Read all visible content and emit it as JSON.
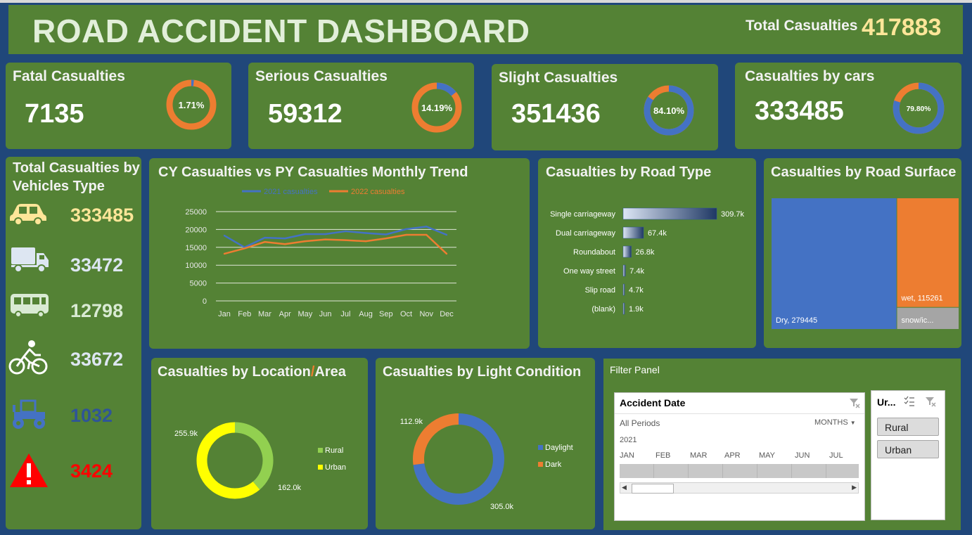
{
  "header": {
    "title": "ROAD ACCIDENT DASHBOARD",
    "total_label": "Total Casualties",
    "total_value": "417883"
  },
  "kpis": [
    {
      "title": "Fatal Casualties",
      "value": "7135",
      "pct_label": "1.71%",
      "pct": 1.71
    },
    {
      "title": "Serious Casualties",
      "value": "59312",
      "pct_label": "14.19%",
      "pct": 14.19
    },
    {
      "title": "Slight Casualties",
      "value": "351436",
      "pct_label": "84.10%",
      "pct": 84.1
    },
    {
      "title": "Casualties by cars",
      "value": "333485",
      "pct_label": "79.80%",
      "pct": 79.8
    }
  ],
  "vehicles": {
    "title_line1": "Total Casualties by",
    "title_line2": "Vehicles Type",
    "items": [
      {
        "icon": "car-icon",
        "value": "333485",
        "color": "#ffe699"
      },
      {
        "icon": "truck-icon",
        "value": "33472",
        "color": "#dde6f2"
      },
      {
        "icon": "bus-icon",
        "value": "12798",
        "color": "#d9ead3"
      },
      {
        "icon": "bicycle-icon",
        "value": "33672",
        "color": "#dde6f2"
      },
      {
        "icon": "tractor-icon",
        "value": "1032",
        "color": "#2f5597"
      },
      {
        "icon": "warning-icon",
        "value": "3424",
        "color": "#ff0000"
      }
    ]
  },
  "trend": {
    "title": "CY  Casualties vs PY Casualties Monthly Trend"
  },
  "road_type": {
    "title": "Casualties by Road Type"
  },
  "road_surface": {
    "title": "Casualties by Road Surface"
  },
  "location": {
    "title_part1": "Casualties by Location",
    "slash": "/",
    "title_part2": "Area"
  },
  "light": {
    "title": "Casualties by Light Condition"
  },
  "filter": {
    "title": "Filter Panel",
    "date_slicer": {
      "title": "Accident Date",
      "period": "All Periods",
      "unit": "MONTHS",
      "year": "2021",
      "months": [
        "JAN",
        "FEB",
        "MAR",
        "APR",
        "MAY",
        "JUN",
        "JUL"
      ]
    },
    "area_slicer": {
      "title": "Ur...",
      "options": [
        "Rural",
        "Urban"
      ]
    }
  },
  "chart_data": [
    {
      "type": "line",
      "title": "CY  Casualties vs PY Casualties Monthly Trend",
      "categories": [
        "Jan",
        "Feb",
        "Mar",
        "Apr",
        "May",
        "Jun",
        "Jul",
        "Aug",
        "Sep",
        "Oct",
        "Nov",
        "Dec"
      ],
      "series": [
        {
          "name": "2021 casualties",
          "color": "#4472c4",
          "values": [
            18300,
            15000,
            17700,
            17500,
            18700,
            18700,
            19500,
            19000,
            18600,
            20100,
            20800,
            18500
          ]
        },
        {
          "name": "2022 casualties",
          "color": "#ed7d31",
          "values": [
            13200,
            14700,
            16500,
            15900,
            16700,
            17200,
            17000,
            16700,
            17500,
            18500,
            18500,
            13200
          ]
        }
      ],
      "ylim": [
        0,
        25000
      ],
      "yticks": [
        0,
        5000,
        10000,
        15000,
        20000,
        25000
      ],
      "grid": true,
      "legend": "top"
    },
    {
      "type": "bar",
      "orientation": "horizontal",
      "title": "Casualties by Road Type",
      "categories": [
        "Single carriageway",
        "Dual carriageway",
        "Roundabout",
        "One way street",
        "Slip road",
        "(blank)"
      ],
      "values": [
        309.7,
        67.4,
        26.8,
        7.4,
        4.7,
        1.9
      ],
      "labels": [
        "309.7k",
        "67.4k",
        "26.8k",
        "7.4k",
        "4.7k",
        "1.9k"
      ]
    },
    {
      "type": "treemap",
      "title": "Casualties by Road Surface",
      "items": [
        {
          "label": "Dry, 279445",
          "value": 279445,
          "color": "#4472c4"
        },
        {
          "label": "wet, 115261",
          "value": 115261,
          "color": "#ed7d31"
        },
        {
          "label": "snow/ic...",
          "value": 23177,
          "color": "#a5a5a5"
        }
      ]
    },
    {
      "type": "pie",
      "title": "Casualties by Location/Area",
      "donut": true,
      "series": [
        {
          "name": "Rural",
          "value": 162.0,
          "label": "162.0k",
          "color": "#92d050"
        },
        {
          "name": "Urban",
          "value": 255.9,
          "label": "255.9k",
          "color": "#ffff00"
        }
      ],
      "legend": "right"
    },
    {
      "type": "pie",
      "title": "Casualties by Light Condition",
      "donut": true,
      "series": [
        {
          "name": "Daylight",
          "value": 305.0,
          "label": "305.0k",
          "color": "#4472c4"
        },
        {
          "name": "Dark",
          "value": 112.9,
          "label": "112.9k",
          "color": "#ed7d31"
        }
      ],
      "legend": "right"
    }
  ],
  "colors": {
    "background": "#20477a",
    "panel": "#548235",
    "orange": "#ed7d31",
    "blue": "#4472c4",
    "gold": "#ffe699"
  }
}
